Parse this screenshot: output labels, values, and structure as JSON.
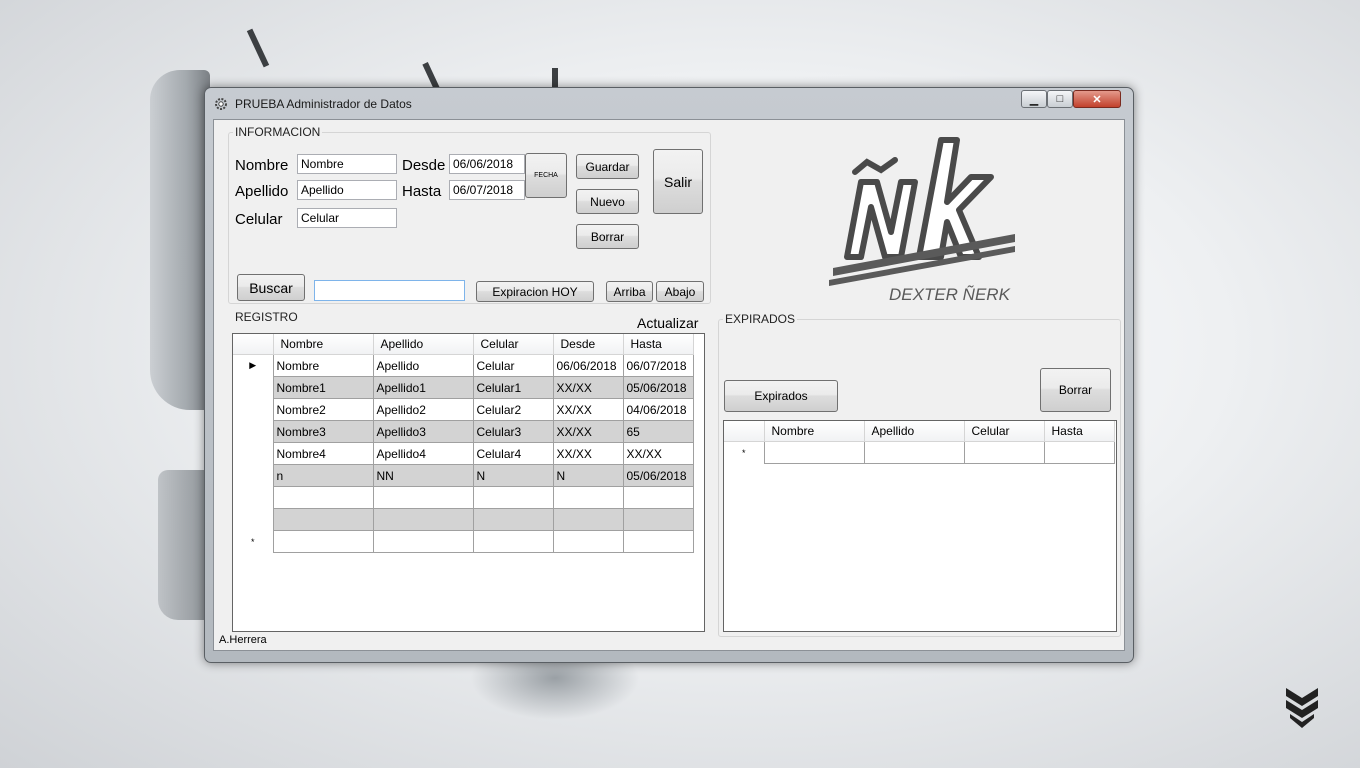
{
  "window": {
    "title": "PRUEBA Administrador de Datos",
    "minimize_glyph": "▁",
    "maximize_glyph": "□",
    "close_glyph": "✕"
  },
  "informacion": {
    "legend": "INFORMACION",
    "nombre_label": "Nombre",
    "nombre_value": "Nombre",
    "apellido_label": "Apellido",
    "apellido_value": "Apellido",
    "celular_label": "Celular",
    "celular_value": "Celular",
    "desde_label": "Desde",
    "desde_value": "06/06/2018",
    "hasta_label": "Hasta",
    "hasta_value": "06/07/2018",
    "fecha_button": "FECHA",
    "guardar_button": "Guardar",
    "nuevo_button": "Nuevo",
    "borrar_button": "Borrar",
    "salir_button": "Salir",
    "buscar_button": "Buscar",
    "search_value": "",
    "expiracion_button": "Expiracion HOY",
    "arriba_button": "Arriba",
    "abajo_button": "Abajo"
  },
  "logo": {
    "mark": "ÑK",
    "text": "DEXTER ÑERK"
  },
  "registro": {
    "legend": "REGISTRO",
    "actualizar": "Actualizar",
    "columns": [
      "Nombre",
      "Apellido",
      "Celular",
      "Desde",
      "Hasta"
    ],
    "rows": [
      [
        "Nombre",
        "Apellido",
        "Celular",
        "06/06/2018",
        "06/07/2018"
      ],
      [
        "Nombre1",
        "Apellido1",
        "Celular1",
        "XX/XX",
        "05/06/2018"
      ],
      [
        "Nombre2",
        "Apellido2",
        "Celular2",
        "XX/XX",
        "04/06/2018"
      ],
      [
        "Nombre3",
        "Apellido3",
        "Celular3",
        "XX/XX",
        "65"
      ],
      [
        "Nombre4",
        "Apellido4",
        "Celular4",
        "XX/XX",
        "XX/XX"
      ],
      [
        "n",
        "NN",
        "N",
        "N",
        "05/06/2018"
      ],
      [
        "",
        "",
        "",
        "",
        ""
      ],
      [
        "",
        "",
        "",
        "",
        ""
      ],
      [
        "",
        "",
        "",
        "",
        ""
      ]
    ],
    "current_row_glyph": "▶",
    "new_row_glyph": "*"
  },
  "expirados": {
    "legend": "EXPIRADOS",
    "expirados_button": "Expirados",
    "borrar_button": "Borrar",
    "columns": [
      "Nombre",
      "Apellido",
      "Celular",
      "Hasta"
    ],
    "new_row_glyph": "*"
  },
  "status": {
    "author": "A.Herrera"
  }
}
